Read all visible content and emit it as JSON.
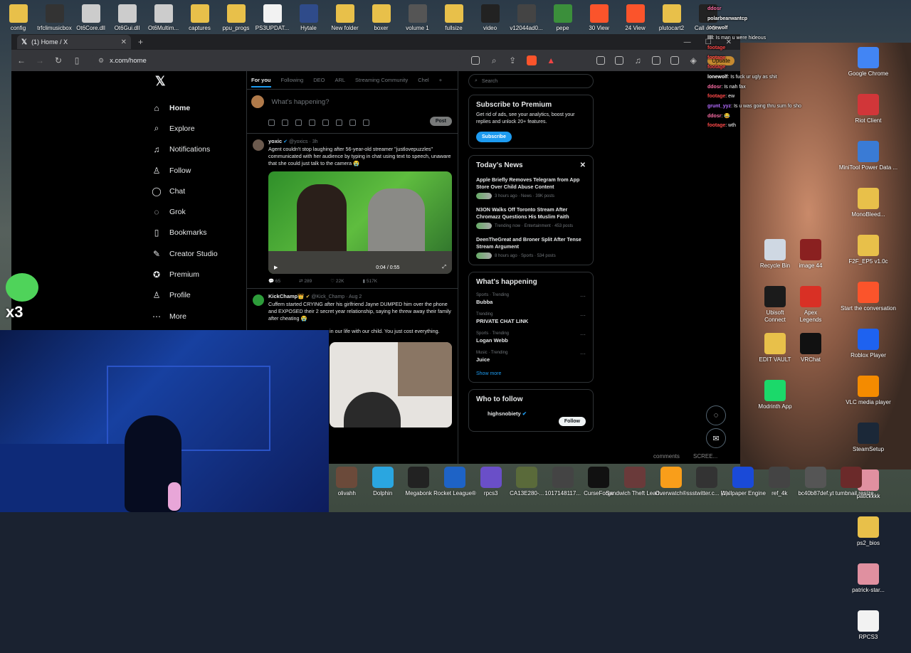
{
  "desktop": {
    "top_icons": [
      {
        "label": "config",
        "color": "#e8c04a"
      },
      {
        "label": "trfclimusicbox",
        "color": "#333333"
      },
      {
        "label": "Ot6Core.dll",
        "color": "#cccccc"
      },
      {
        "label": "Ot6Gui.dll",
        "color": "#cccccc"
      },
      {
        "label": "Ot6Multim...",
        "color": "#cccccc"
      },
      {
        "label": "captures",
        "color": "#e8c04a"
      },
      {
        "label": "ppu_progs",
        "color": "#e8c04a"
      },
      {
        "label": "PS3UPDAT...",
        "color": "#f2f2f2"
      },
      {
        "label": "Hytale",
        "color": "#2f4b8a"
      },
      {
        "label": "New folder",
        "color": "#e8c04a"
      },
      {
        "label": "boxer",
        "color": "#e8c04a"
      },
      {
        "label": "volume 1",
        "color": "#555555"
      },
      {
        "label": "fullsize",
        "color": "#e8c04a"
      },
      {
        "label": "video",
        "color": "#222222"
      },
      {
        "label": "v12044ad0...",
        "color": "#444444"
      },
      {
        "label": "pepe",
        "color": "#3b8f3b"
      },
      {
        "label": "30 View",
        "color": "#fb542b"
      },
      {
        "label": "24 View",
        "color": "#fb542b"
      },
      {
        "label": "plutocart2",
        "color": "#e8c04a"
      },
      {
        "label": "Call of D...",
        "color": "#222222"
      }
    ],
    "right_icons": [
      {
        "label": "Google Chrome",
        "color": "#4285f4"
      },
      {
        "label": "Riot Client",
        "color": "#d13639"
      },
      {
        "label": "MiniTool Power Data ...",
        "color": "#3a7bd5"
      },
      {
        "label": "MonoBleed...",
        "color": "#e8c04a"
      },
      {
        "label": "F2F_EP5 v1.0c",
        "color": "#e8c04a"
      },
      {
        "label": "Start the conversation",
        "color": "#fb542b"
      },
      {
        "label": "Roblox Player",
        "color": "#1e62f0"
      },
      {
        "label": "VLC media player",
        "color": "#f48b00"
      },
      {
        "label": "SteamSetup",
        "color": "#1b2838"
      },
      {
        "label": "patickkkk",
        "color": "#e090a0"
      },
      {
        "label": "ps2_bios",
        "color": "#e8c04a"
      },
      {
        "label": "patrick-star...",
        "color": "#e090a0"
      },
      {
        "label": "RPCS3",
        "color": "#f2f2f2"
      }
    ],
    "mid_icons": [
      {
        "label": "Recycle Bin",
        "color": "#cfd8e3"
      },
      {
        "label": "image 44",
        "color": "#8a2020"
      },
      {
        "label": "Ubisoft Connect",
        "color": "#1b1b1b"
      },
      {
        "label": "Apex Legends",
        "color": "#d93025"
      },
      {
        "label": "EDIT VAULT",
        "color": "#e8c04a"
      },
      {
        "label": "VRChat",
        "color": "#111111"
      },
      {
        "label": "Modrinth App",
        "color": "#1bd96a"
      }
    ],
    "bottom_icons": [
      {
        "label": "olivahh",
        "color": "#6b4a3a"
      },
      {
        "label": "Dolphin",
        "color": "#2aa6e0"
      },
      {
        "label": "Megabonk",
        "color": "#222222"
      },
      {
        "label": "Rocket League®",
        "color": "#1e63c6"
      },
      {
        "label": "rpcs3",
        "color": "#6a4fc8"
      },
      {
        "label": "CA13E280-...",
        "color": "#5a6a3a"
      },
      {
        "label": "1017148117...",
        "color": "#444444"
      },
      {
        "label": "CurseForge",
        "color": "#111111"
      },
      {
        "label": "Sandwich Theft Lead...",
        "color": "#6a3a3a"
      },
      {
        "label": "Overwatch®",
        "color": "#f99e1a"
      },
      {
        "label": "ssstwitter.c... (1)",
        "color": "#333333"
      },
      {
        "label": "Wallpaper Engine",
        "color": "#1a4ad8"
      },
      {
        "label": "ref_4k",
        "color": "#444444"
      },
      {
        "label": "bc40b87def...",
        "color": "#555555"
      },
      {
        "label": "yt tumbnail resize",
        "color": "#6b2a2a"
      }
    ]
  },
  "browser": {
    "tab_title": "(1) Home / X",
    "url": "x.com/home",
    "update_label": "Update"
  },
  "nav": {
    "items": [
      {
        "label": "Home",
        "icon": "home-icon",
        "glyph": "⌂"
      },
      {
        "label": "Explore",
        "icon": "search-icon",
        "glyph": "⌕"
      },
      {
        "label": "Notifications",
        "icon": "bell-icon",
        "glyph": "♫"
      },
      {
        "label": "Follow",
        "icon": "follow-icon",
        "glyph": "♙"
      },
      {
        "label": "Chat",
        "icon": "chat-icon",
        "glyph": "◯"
      },
      {
        "label": "Grok",
        "icon": "grok-icon",
        "glyph": "◌"
      },
      {
        "label": "Bookmarks",
        "icon": "bookmark-icon",
        "glyph": "▯"
      },
      {
        "label": "Creator Studio",
        "icon": "creator-studio-icon",
        "glyph": "✎"
      },
      {
        "label": "Premium",
        "icon": "premium-icon",
        "glyph": "✪"
      },
      {
        "label": "Profile",
        "icon": "profile-icon",
        "glyph": "♙"
      },
      {
        "label": "More",
        "icon": "more-icon",
        "glyph": "⋯"
      }
    ]
  },
  "timeline": {
    "tabs": [
      "For you",
      "Following",
      "DEO",
      "ARL",
      "Streaming Community",
      "Chel"
    ],
    "composer_placeholder": "What's happening?",
    "post_label": "Post",
    "tweets": [
      {
        "name": "yoxic",
        "handle": "@yoxics · 3h",
        "text": "Agent couldn't stop laughing after 56-year-old streamer \"justlovepuzzles\" communicated with her audience by typing in chat using text to speech, unaware that she could just talk to the camera 😭",
        "video_time": "0:04 / 0:55",
        "replies": "65",
        "reposts": "289",
        "likes": "22K",
        "views": "517K"
      },
      {
        "name": "KickChamp👑",
        "handle": "@Kick_Champ · Aug 2",
        "text": "Cuffem started CRYING after his girlfriend Jayne DUMPED him over the phone and EXPOSED their 2 secret year relationship, saying he threw away their family after cheating 😭",
        "text2": "in our life with our child. You just cost everything."
      }
    ]
  },
  "sidebar": {
    "search_placeholder": "Search",
    "premium": {
      "title": "Subscribe to Premium",
      "text": "Get rid of ads, see your analytics, boost your replies and unlock 20+ features.",
      "button": "Subscribe"
    },
    "news": {
      "title": "Today's News",
      "items": [
        {
          "title": "Apple Briefly Removes Telegram from App Store Over Child Abuse Content",
          "meta": "3 hours ago · News · 39K posts"
        },
        {
          "title": "N3ON Walks Off Toronto Stream After Chromazz Questions His Muslim Faith",
          "meta": "Trending now · Entertainment · 453 posts"
        },
        {
          "title": "DeenTheGreat and Broner Split After Tense Stream Argument",
          "meta": "8 hours ago · Sports · 534 posts"
        }
      ]
    },
    "happening": {
      "title": "What's happening",
      "trends": [
        {
          "context": "Sports · Trending",
          "name": "Bubba"
        },
        {
          "context": "Trending",
          "name": "PRIVATE CHAT LINK"
        },
        {
          "context": "Sports · Trending",
          "name": "Logan Webb"
        },
        {
          "context": "Music · Trending",
          "name": "Juice"
        }
      ],
      "show_more": "Show more"
    },
    "who_to_follow": {
      "title": "Who to follow",
      "user": "highsnobiety",
      "follow_label": "Follow"
    }
  },
  "stream_chat": [
    {
      "user": "ddosr",
      "msg": "",
      "color": "#ff6fa8"
    },
    {
      "user": "polarbearwantcp",
      "msg": "",
      "color": "#ffffff"
    },
    {
      "user": "lonewolf",
      "msg": "",
      "color": "#ffffff"
    },
    {
      "user": "llll",
      "msg": ": Is man u were hideous",
      "color": "#ffffff"
    },
    {
      "user": "",
      "msg": "",
      "color": "#ffffff"
    },
    {
      "user": "",
      "msg": "",
      "color": "#ffffff"
    },
    {
      "user": "footage",
      "msg": "",
      "color": "#ff4a4a"
    },
    {
      "user": "footage",
      "msg": "",
      "color": "#ff4a4a"
    },
    {
      "user": "footage",
      "msg": "",
      "color": "#ff4a4a"
    },
    {
      "user": "lonewolf",
      "msg": ": Is fuck ur ugly as shit",
      "color": "#ffffff"
    },
    {
      "user": "ddosr",
      "msg": ": Is nah fax",
      "color": "#ff6fa8"
    },
    {
      "user": "footage",
      "msg": ": ew",
      "color": "#ff4a4a"
    },
    {
      "user": "grunt_yyz",
      "msg": ": Is u was going thru sum fo sho",
      "color": "#b36bff"
    },
    {
      "user": "ddosr",
      "msg": ": 😂",
      "color": "#ff6fa8"
    },
    {
      "user": "footage",
      "msg": ": wth",
      "color": "#ff4a4a"
    }
  ],
  "stream_badge": {
    "count": "x3"
  },
  "background_labels": {
    "comments": "comments",
    "screen": "SCREE..."
  }
}
